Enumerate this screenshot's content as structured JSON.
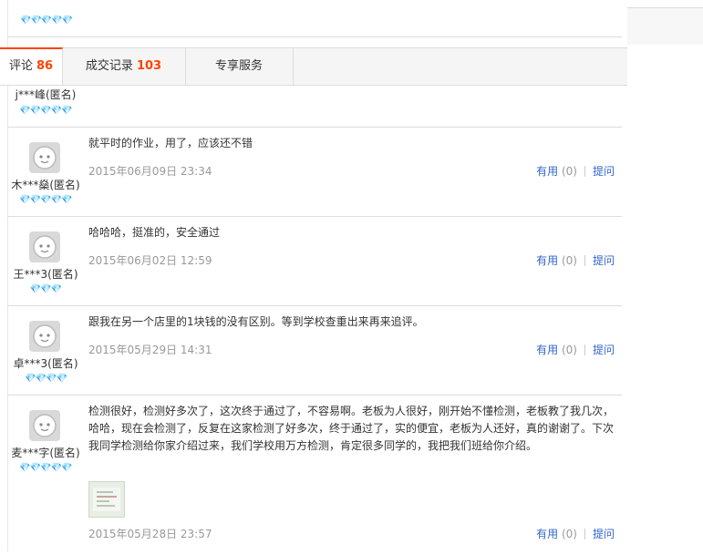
{
  "top_entry": {
    "stars": "💎💎💎💎💎"
  },
  "tabs": [
    {
      "label": "评论",
      "count": "86"
    },
    {
      "label": "成交记录",
      "count": "103"
    },
    {
      "label": "专享服务",
      "count": ""
    }
  ],
  "partial_review": {
    "user": "j***峰(匿名)",
    "stars": "💎💎💎💎💎"
  },
  "reviews": [
    {
      "user": "木***燊(匿名)",
      "stars": "💎💎💎💎💎",
      "text": "就平时的作业，用了，应该还不错",
      "date": "2015年06月09日 23:34",
      "useful": "有用",
      "useful_count": "(0)",
      "ask": "提问"
    },
    {
      "user": "王***3(匿名)",
      "stars": "💎💎💎",
      "text": "哈哈哈，挺准的，安全通过",
      "date": "2015年06月02日 12:59",
      "useful": "有用",
      "useful_count": "(0)",
      "ask": "提问"
    },
    {
      "user": "卓***3(匿名)",
      "stars": "💎💎💎💎",
      "text": "跟我在另一个店里的1块钱的没有区别。等到学校查重出来再来追评。",
      "date": "2015年05月29日 14:31",
      "useful": "有用",
      "useful_count": "(0)",
      "ask": "提问"
    },
    {
      "user": "麦***字(匿名)",
      "stars": "💎💎💎💎💎",
      "text": "检测很好，检测好多次了，这次终于通过了，不容易啊。老板为人很好，刚开始不懂检测，老板教了我几次，哈哈，现在会检测了，反复在这家检测了好多次，终于通过了，实的便宜，老板为人还好，真的谢谢了。下次我同学检测给你家介绍过来，我们学校用万方检测，肯定很多同学的，我把我们班给你介绍。",
      "date": "2015年05月28日 23:57",
      "useful": "有用",
      "useful_count": "(0)",
      "ask": "提问"
    }
  ]
}
